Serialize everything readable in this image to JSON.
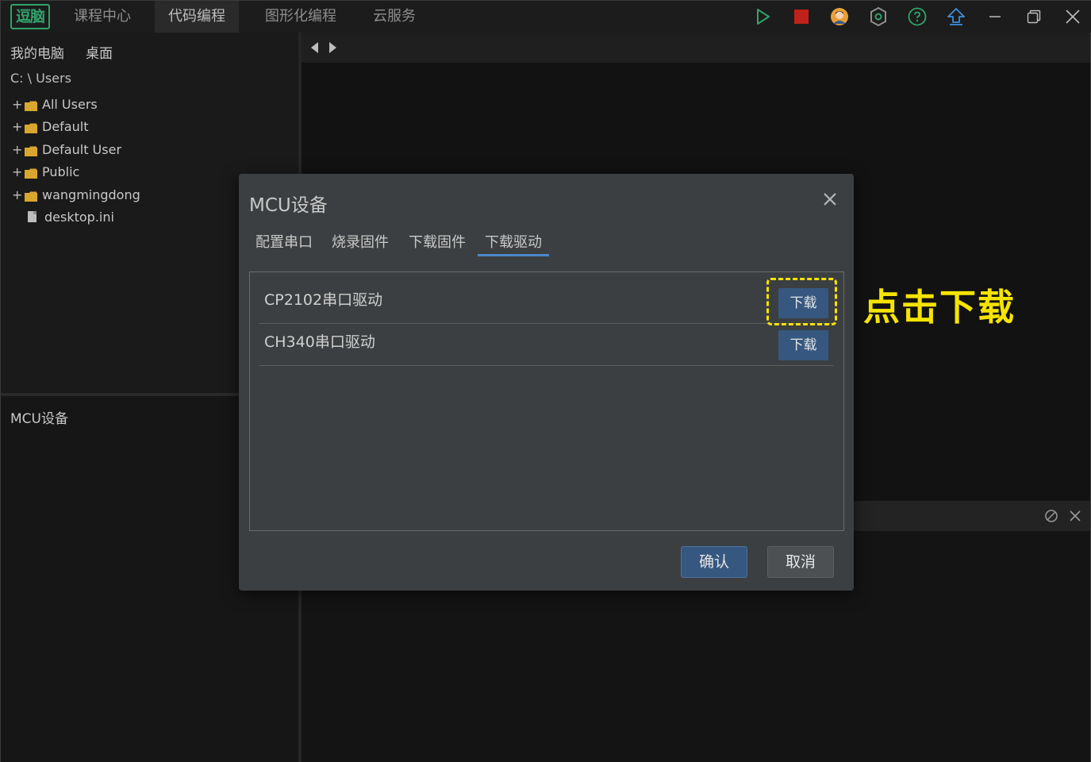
{
  "app": {
    "logo_text": "逗脑",
    "tabs": [
      {
        "label": "课程中心"
      },
      {
        "label": "代码编程"
      },
      {
        "label": "图形化编程"
      },
      {
        "label": "云服务"
      }
    ],
    "active_tab": "代码编程",
    "toolbar_icons": [
      "run-icon",
      "stop-icon",
      "user-avatar-icon",
      "hex-settings-icon",
      "help-icon",
      "upload-icon"
    ],
    "window_controls": [
      "minimize-icon",
      "restore-icon",
      "close-icon"
    ],
    "colors": {
      "brand": "#2fa36b",
      "run": "#2fa36b",
      "stop": "#c0221b",
      "accent": "#4a88c7",
      "button_primary": "#365880",
      "annotation": "#f5e400"
    }
  },
  "sidebar": {
    "locations": [
      "我的电脑",
      "桌面"
    ],
    "path": "C: \\ Users",
    "tree": [
      {
        "type": "folder",
        "name": "All Users"
      },
      {
        "type": "folder",
        "name": "Default"
      },
      {
        "type": "folder",
        "name": "Default User"
      },
      {
        "type": "folder",
        "name": "Public"
      },
      {
        "type": "folder",
        "name": "wangmingdong"
      },
      {
        "type": "file",
        "name": "desktop.ini"
      }
    ],
    "panel_title": "MCU设备"
  },
  "dialog": {
    "title": "MCU设备",
    "tabs": [
      {
        "label": "配置串口"
      },
      {
        "label": "烧录固件"
      },
      {
        "label": "下载固件"
      },
      {
        "label": "下载驱动"
      }
    ],
    "active_tab": "下载驱动",
    "drivers": [
      {
        "name": "CP2102串口驱动",
        "button": "下载"
      },
      {
        "name": "CH340串口驱动",
        "button": "下载"
      }
    ],
    "ok_label": "确认",
    "cancel_label": "取消"
  },
  "annotation": {
    "text": "点击下载"
  }
}
